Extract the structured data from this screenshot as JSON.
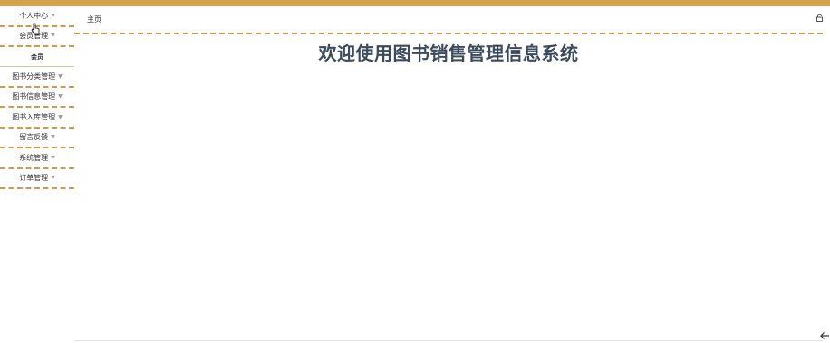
{
  "sidebar": {
    "items": [
      {
        "label": "个人中心"
      },
      {
        "label": "会员管理"
      },
      {
        "label": "会员"
      },
      {
        "label": "图书分类管理"
      },
      {
        "label": "图书信息管理"
      },
      {
        "label": "图书入库管理"
      },
      {
        "label": "留言反馈"
      },
      {
        "label": "系统管理"
      },
      {
        "label": "订单管理"
      }
    ]
  },
  "header": {
    "breadcrumb": "主页"
  },
  "main": {
    "title": "欢迎使用图书销售管理信息系统"
  },
  "colors": {
    "accent": "#d6a24b",
    "title": "#3b4b5c"
  },
  "icons": {
    "logout": "logout-icon",
    "back": "back-arrow-icon",
    "cursor": "hand-cursor-icon"
  }
}
